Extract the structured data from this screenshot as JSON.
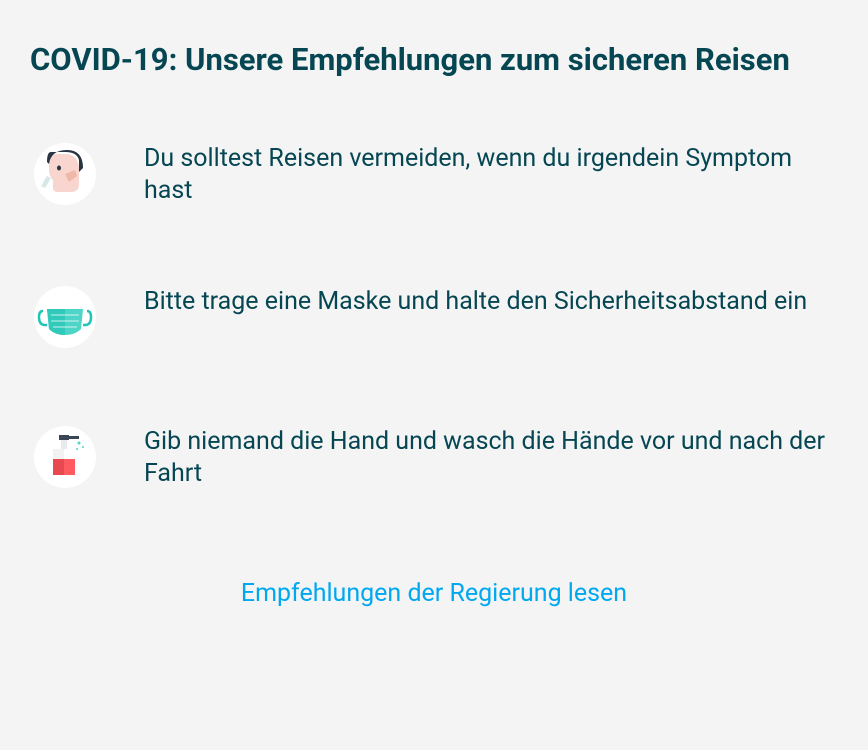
{
  "title": "COVID-19: Unsere Empfehlungen zum sicheren Reisen",
  "recommendations": [
    {
      "icon": "sick-person-icon",
      "text": "Du solltest Reisen vermeiden, wenn du irgendein Symptom hast"
    },
    {
      "icon": "mask-icon",
      "text": "Bitte trage eine Maske und halte den Sicherheitsabstand ein"
    },
    {
      "icon": "wash-hands-icon",
      "text": "Gib niemand die Hand und wasch die Hände vor und nach der Fahrt"
    }
  ],
  "link": "Empfehlungen der Regierung lesen"
}
